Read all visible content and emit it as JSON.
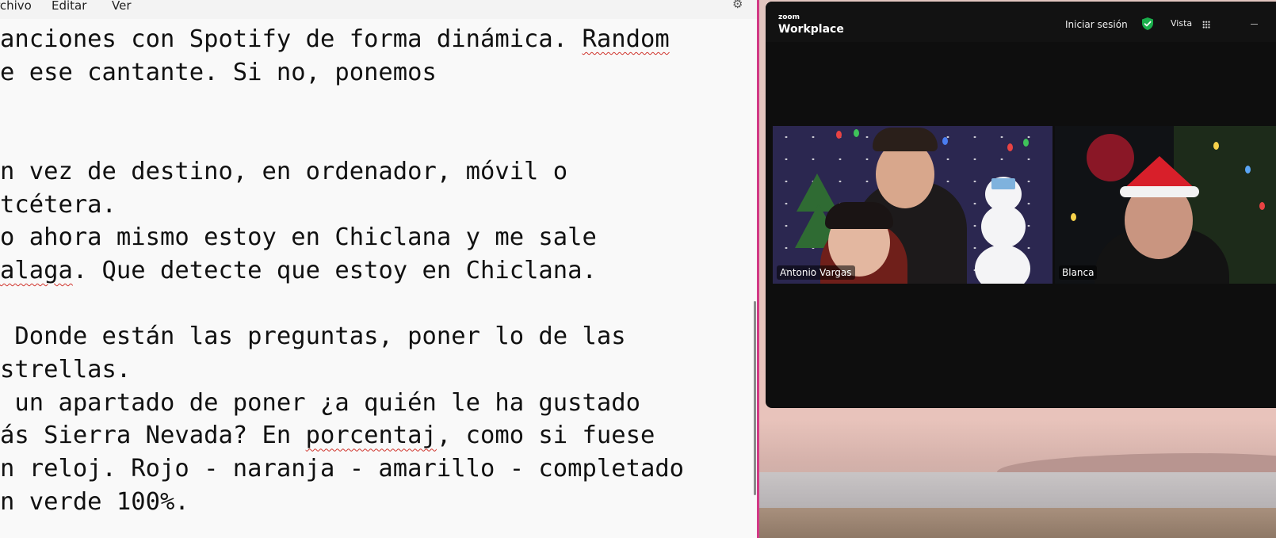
{
  "notepad": {
    "menu": [
      "rchivo",
      "Editar",
      "Ver"
    ],
    "lines": [
      {
        "segments": [
          {
            "text": "anciones con Spotify de forma dinámica. "
          },
          {
            "text": "Random",
            "misspelled": true
          }
        ]
      },
      {
        "segments": [
          {
            "text": "e ese cantante. Si no, ponemos"
          }
        ]
      },
      {
        "segments": [
          {
            "text": ""
          }
        ]
      },
      {
        "segments": [
          {
            "text": ""
          }
        ]
      },
      {
        "segments": [
          {
            "text": "n vez de destino, en ordenador, móvil o"
          }
        ]
      },
      {
        "segments": [
          {
            "text": "tcétera."
          }
        ]
      },
      {
        "segments": [
          {
            "text": "o ahora mismo estoy en Chiclana y me sale"
          }
        ]
      },
      {
        "segments": [
          {
            "text": "alaga",
            "misspelled": true
          },
          {
            "text": ". Que detecte que estoy en Chiclana."
          }
        ]
      },
      {
        "segments": [
          {
            "text": ""
          }
        ]
      },
      {
        "segments": [
          {
            "text": " Donde están las preguntas, poner lo de las"
          }
        ]
      },
      {
        "segments": [
          {
            "text": "strellas."
          }
        ]
      },
      {
        "segments": [
          {
            "text": " un apartado de poner ¿a quién le ha gustado"
          }
        ]
      },
      {
        "segments": [
          {
            "text": "ás Sierra Nevada? En "
          },
          {
            "text": "porcentaj",
            "misspelled": true
          },
          {
            "text": ", como si fuese"
          }
        ]
      },
      {
        "segments": [
          {
            "text": "n reloj. Rojo - naranja - amarillo - completado"
          }
        ]
      },
      {
        "segments": [
          {
            "text": "n verde 100%."
          }
        ]
      }
    ]
  },
  "zoom": {
    "brand_small": "zoom",
    "brand_name": "Workplace",
    "signin_label": "Iniciar sesión",
    "security_icon": "shield-check-icon",
    "view_label": "Vista",
    "view_icon": "grid-icon",
    "minimize_icon": "minimize-icon",
    "participants": [
      {
        "name": "Antonio Vargas"
      },
      {
        "name": "Blanca"
      }
    ],
    "colors": {
      "shield": "#1aae4b",
      "window_bg": "#0e0e0e",
      "divider": "#d23a86"
    }
  }
}
